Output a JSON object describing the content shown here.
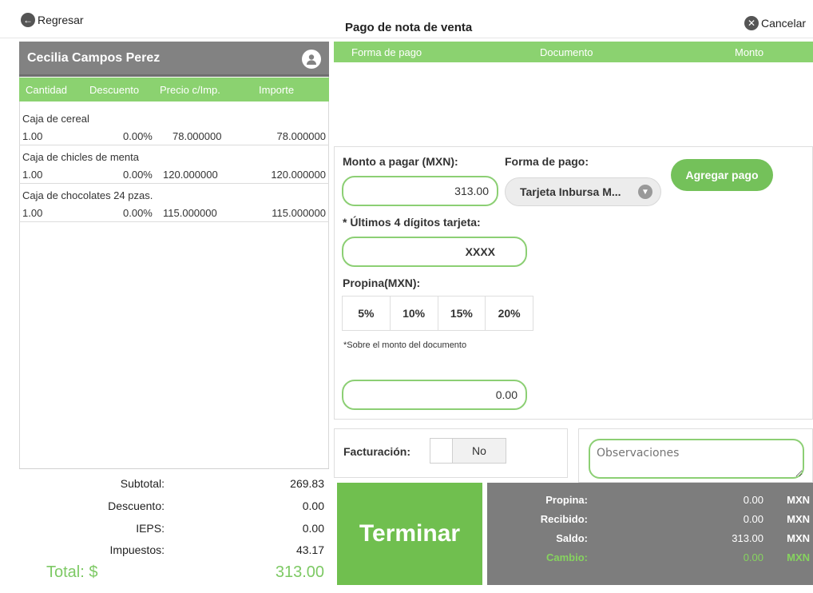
{
  "header": {
    "back_label": "Regresar",
    "title": "Pago de nota de venta",
    "cancel_label": "Cancelar"
  },
  "customer": {
    "name": "Cecilia Campos Perez"
  },
  "items_table": {
    "columns": [
      "Cantidad",
      "Descuento",
      "Precio c/Imp.",
      "Importe"
    ],
    "rows": [
      {
        "name": "Caja de cereal",
        "qty": "1.00",
        "discount": "0.00%",
        "price": "78.000000",
        "amount": "78.000000"
      },
      {
        "name": "Caja de chicles de menta",
        "qty": "1.00",
        "discount": "0.00%",
        "price": "120.000000",
        "amount": "120.000000"
      },
      {
        "name": "Caja de chocolates 24 pzas.",
        "qty": "1.00",
        "discount": "0.00%",
        "price": "115.000000",
        "amount": "115.000000"
      }
    ]
  },
  "totals": {
    "subtotal_label": "Subtotal:",
    "subtotal": "269.83",
    "discount_label": "Descuento:",
    "discount": "0.00",
    "ieps_label": "IEPS:",
    "ieps": "0.00",
    "taxes_label": "Impuestos:",
    "taxes": "43.17",
    "total_label": "Total: $",
    "total": "313.00"
  },
  "payments_table": {
    "columns": [
      "Forma de pago",
      "Documento",
      "Monto"
    ]
  },
  "payment_form": {
    "amount_label": "Monto a pagar (MXN):",
    "amount_value": "313.00",
    "method_label": "Forma de pago:",
    "method_value": "Tarjeta Inbursa M...",
    "add_button": "Agregar pago",
    "card_label": "* Últimos 4 dígitos tarjeta:",
    "card_value": "XXXX",
    "tip_label": "Propina(MXN):",
    "tip_options": [
      "5%",
      "10%",
      "15%",
      "20%"
    ],
    "tip_note": "*Sobre el monto del documento",
    "tip_value": "0.00"
  },
  "invoice": {
    "label": "Facturación:",
    "toggle_value": "No"
  },
  "notes": {
    "placeholder": "Observaciones"
  },
  "finish_button": "Terminar",
  "summary": {
    "tip_label": "Propina:",
    "tip_value": "0.00",
    "tip_unit": "MXN",
    "received_label": "Recibido:",
    "received_value": "0.00",
    "received_unit": "MXN",
    "balance_label": "Saldo:",
    "balance_value": "313.00",
    "balance_unit": "MXN",
    "change_label": "Cambio:",
    "change_value": "0.00",
    "change_unit": "MXN"
  },
  "colors": {
    "accent_green": "#8bd270",
    "button_green": "#70bf4f",
    "header_gray": "#828282",
    "summary_gray": "#7d7d7d"
  }
}
